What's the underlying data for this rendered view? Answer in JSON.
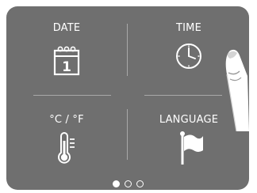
{
  "menu": {
    "tiles": [
      {
        "label": "DATE",
        "icon": "calendar-icon",
        "day_number": "1"
      },
      {
        "label": "TIME",
        "icon": "clock-icon"
      },
      {
        "label": "°C / °F",
        "icon": "thermometer-icon"
      },
      {
        "label": "LANGUAGE",
        "icon": "flag-icon"
      }
    ]
  },
  "pagination": {
    "pages": 3,
    "current": 1
  },
  "colors": {
    "panel": "#6f6f6f",
    "divider": "#a9a9a9",
    "foreground": "#ffffff"
  }
}
